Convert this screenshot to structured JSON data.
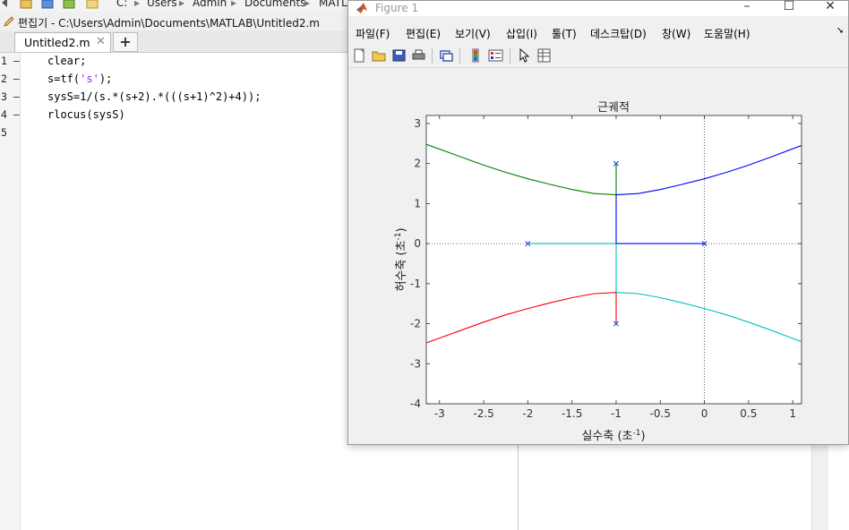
{
  "main": {
    "path_segments": [
      "C:",
      "Users",
      "Admin",
      "Documents",
      "MATL"
    ],
    "editor_title": "편집기 - C:\\Users\\Admin\\Documents\\MATLAB\\Untitled2.m",
    "tab_label": "Untitled2.m",
    "tab_close": "✕",
    "tab_add": "+",
    "line_numbers": [
      "1 –",
      "2 –",
      "3 –",
      "4 –",
      "5"
    ],
    "code": {
      "line1": "clear;",
      "line2_pre": "s=tf(",
      "line2_str": "'s'",
      "line2_post": ");",
      "line3": "sysS=1/(s.*(s+2).*(((s+1)^2)+4));",
      "line4": "rlocus(sysS)"
    }
  },
  "figure": {
    "title": "Figure 1",
    "menu": [
      "파일(F)",
      "편집(E)",
      "보기(V)",
      "삽입(I)",
      "툴(T)",
      "데스크탑(D)",
      "창(W)",
      "도움말(H)"
    ],
    "menu_arrow": "➘",
    "toolbar_icons": [
      "new-figure-icon",
      "open-file-icon",
      "save-icon",
      "print-icon",
      "link-icon",
      "colorbar-icon",
      "legend-icon",
      "pointer-icon",
      "property-inspector-icon"
    ]
  },
  "chart_data": {
    "type": "line",
    "title": "근궤적",
    "xlabel": "실수축 (초",
    "ylabel": "허수축 (초",
    "label_sup": "-1",
    "xlim": [
      -3.15,
      1.1
    ],
    "ylim": [
      -4,
      3.2
    ],
    "xticks": [
      -3,
      -2.5,
      -2,
      -1.5,
      -1,
      -0.5,
      0,
      0.5,
      1
    ],
    "xtick_labels": [
      "-3",
      "-2.5",
      "-2",
      "-1.5",
      "-1",
      "-0.5",
      "0",
      "0.5",
      "1"
    ],
    "yticks": [
      3,
      2,
      1,
      0,
      -1,
      -2,
      -3,
      -4
    ],
    "ytick_labels": [
      "3",
      "2",
      "1",
      "0",
      "-1",
      "-2",
      "-3",
      "-4"
    ],
    "grid": false,
    "poles": [
      [
        0,
        0
      ],
      [
        -2,
        0
      ],
      [
        -1,
        2
      ],
      [
        -1,
        -2
      ]
    ],
    "pole_color": "#1f4fd0",
    "series": [
      {
        "color": "#0000ff",
        "points": [
          [
            0,
            0
          ],
          [
            -1,
            0
          ]
        ]
      },
      {
        "color": "#00bfbf",
        "points": [
          [
            -2,
            0
          ],
          [
            -1,
            0
          ]
        ]
      },
      {
        "color": "#0000ff",
        "points": [
          [
            -1,
            0
          ],
          [
            -1,
            1.22
          ]
        ]
      },
      {
        "color": "#00bfbf",
        "points": [
          [
            -1,
            0
          ],
          [
            -1,
            -1.22
          ]
        ]
      },
      {
        "color": "#007f00",
        "points": [
          [
            -1,
            2
          ],
          [
            -1,
            1.22
          ]
        ]
      },
      {
        "color": "#ff0000",
        "points": [
          [
            -1,
            -2
          ],
          [
            -1,
            -1.22
          ]
        ]
      },
      {
        "color": "#0000ff",
        "points": [
          [
            -1,
            1.22
          ],
          [
            -0.75,
            1.25
          ],
          [
            -0.5,
            1.35
          ],
          [
            -0.25,
            1.48
          ],
          [
            0,
            1.62
          ],
          [
            0.25,
            1.78
          ],
          [
            0.5,
            1.96
          ],
          [
            0.75,
            2.16
          ],
          [
            1.1,
            2.45
          ]
        ]
      },
      {
        "color": "#007f00",
        "points": [
          [
            -1,
            1.22
          ],
          [
            -1.25,
            1.25
          ],
          [
            -1.5,
            1.35
          ],
          [
            -1.75,
            1.48
          ],
          [
            -2,
            1.62
          ],
          [
            -2.25,
            1.78
          ],
          [
            -2.5,
            1.96
          ],
          [
            -2.75,
            2.16
          ],
          [
            -3.15,
            2.48
          ]
        ]
      },
      {
        "color": "#00bfbf",
        "points": [
          [
            -1,
            -1.22
          ],
          [
            -0.75,
            -1.25
          ],
          [
            -0.5,
            -1.35
          ],
          [
            -0.25,
            -1.48
          ],
          [
            0,
            -1.62
          ],
          [
            0.25,
            -1.78
          ],
          [
            0.5,
            -1.96
          ],
          [
            0.75,
            -2.16
          ],
          [
            1.1,
            -2.45
          ]
        ]
      },
      {
        "color": "#ff0000",
        "points": [
          [
            -1,
            -1.22
          ],
          [
            -1.25,
            -1.25
          ],
          [
            -1.5,
            -1.35
          ],
          [
            -1.75,
            -1.48
          ],
          [
            -2,
            -1.62
          ],
          [
            -2.25,
            -1.78
          ],
          [
            -2.5,
            -1.96
          ],
          [
            -2.75,
            -2.16
          ],
          [
            -3.15,
            -2.48
          ]
        ]
      }
    ]
  }
}
